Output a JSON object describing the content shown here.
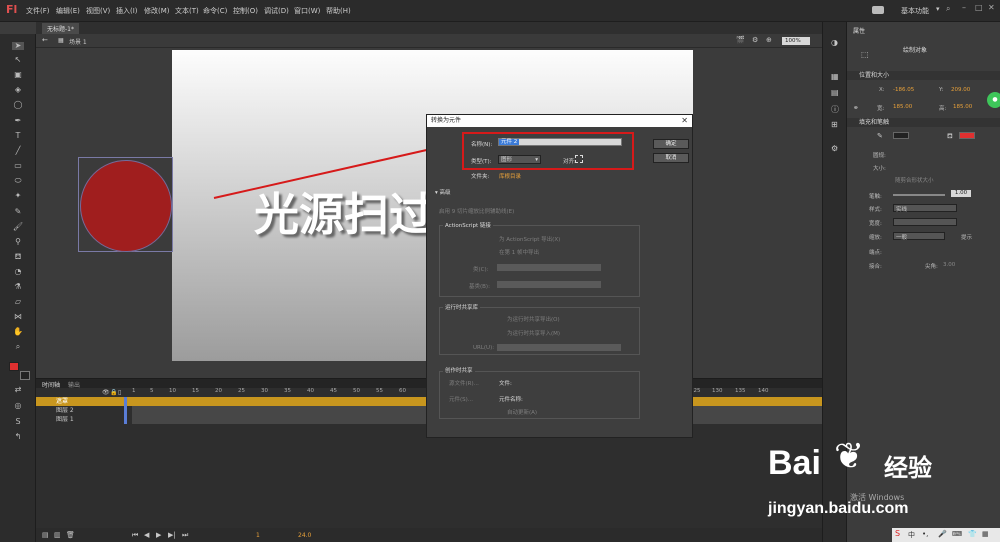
{
  "app": {
    "logo": "Fl",
    "workspace": "基本功能",
    "search_icon": "magnifier-icon"
  },
  "menus": [
    "文件(F)",
    "编辑(E)",
    "视图(V)",
    "插入(I)",
    "修改(M)",
    "文本(T)",
    "命令(C)",
    "控制(O)",
    "调试(D)",
    "窗口(W)",
    "帮助(H)"
  ],
  "document": {
    "tab": "无标题-1*",
    "scene": "场景 1",
    "zoom": "100%"
  },
  "stage": {
    "big_text": "光源扫过",
    "circle_color": "#a01e1e"
  },
  "timeline": {
    "tabs": [
      "时间轴",
      "输出"
    ],
    "layers": [
      "遮罩",
      "图层 2",
      "图层 1"
    ],
    "ruler": [
      "1",
      "5",
      "10",
      "15",
      "20",
      "25",
      "30",
      "35",
      "40",
      "45",
      "50",
      "55",
      "60",
      "65",
      "70",
      "75",
      "80",
      "85",
      "90",
      "95",
      "100",
      "105",
      "110",
      "115",
      "120",
      "125",
      "130",
      "135",
      "140"
    ],
    "fps": "24.0",
    "frame": "1"
  },
  "properties": {
    "tab": "属性",
    "object": "绘制对象",
    "section_pos": "位置和大小",
    "x_label": "X:",
    "x_val": "-186.05",
    "y_label": "Y:",
    "y_val": "209.00",
    "w_label": "宽:",
    "w_val": "185.00",
    "h_label": "高:",
    "h_val": "185.00",
    "section_fill": "填充和笔触",
    "stroke_label": "笔触:",
    "stroke_val": "1.00",
    "style_label": "样式:",
    "style_val": "实线",
    "width_label": "宽度:",
    "scale_label": "缩放:",
    "scale_val": "一般",
    "hint": "提示",
    "cap_label": "端点:",
    "join_label": "接合:",
    "miter_label": "尖角:",
    "miter_val": "3.00",
    "circle_label": "圆规:",
    "size_label": "大小:",
    "follow_label": "随剪合形状大小"
  },
  "dialog": {
    "title": "转换为元件",
    "name_label": "名称(N):",
    "name_value": "元件 2",
    "type_label": "类型(T):",
    "type_value": "图形",
    "align_label": "对齐:",
    "folder_label": "文件夹:",
    "folder_value": "库根目录",
    "ok": "确定",
    "cancel": "取消",
    "advanced": "高级",
    "guides": "启用 9 切片缩放比例辅助线(E)",
    "as_header": "ActionScript 链接",
    "as_export": "为 ActionScript 导出(X)",
    "as_frame": "在第 1 帧中导出",
    "class_label": "类(C):",
    "base_label": "基类(B):",
    "rsl_header": "运行时共享库",
    "rsl_export": "为运行时共享导出(O)",
    "rsl_import": "为运行时共享导入(M)",
    "url_label": "URL(U):",
    "author_header": "创作时共享",
    "source_file": "源文件(R)...",
    "file_label": "文件:",
    "symbol_btn": "元件(S)...",
    "symbol_label": "元件名称:",
    "auto_update": "自动更新(A)"
  },
  "watermark": {
    "brand": "Bai",
    "paw": "du",
    "suffix": "经验",
    "url": "jingyan.baidu.com",
    "activate": "激活 Windows"
  },
  "colors": {
    "accent_red": "#d61a1a",
    "orange": "#e8a13a",
    "stroke_swatch": "#e03030"
  }
}
